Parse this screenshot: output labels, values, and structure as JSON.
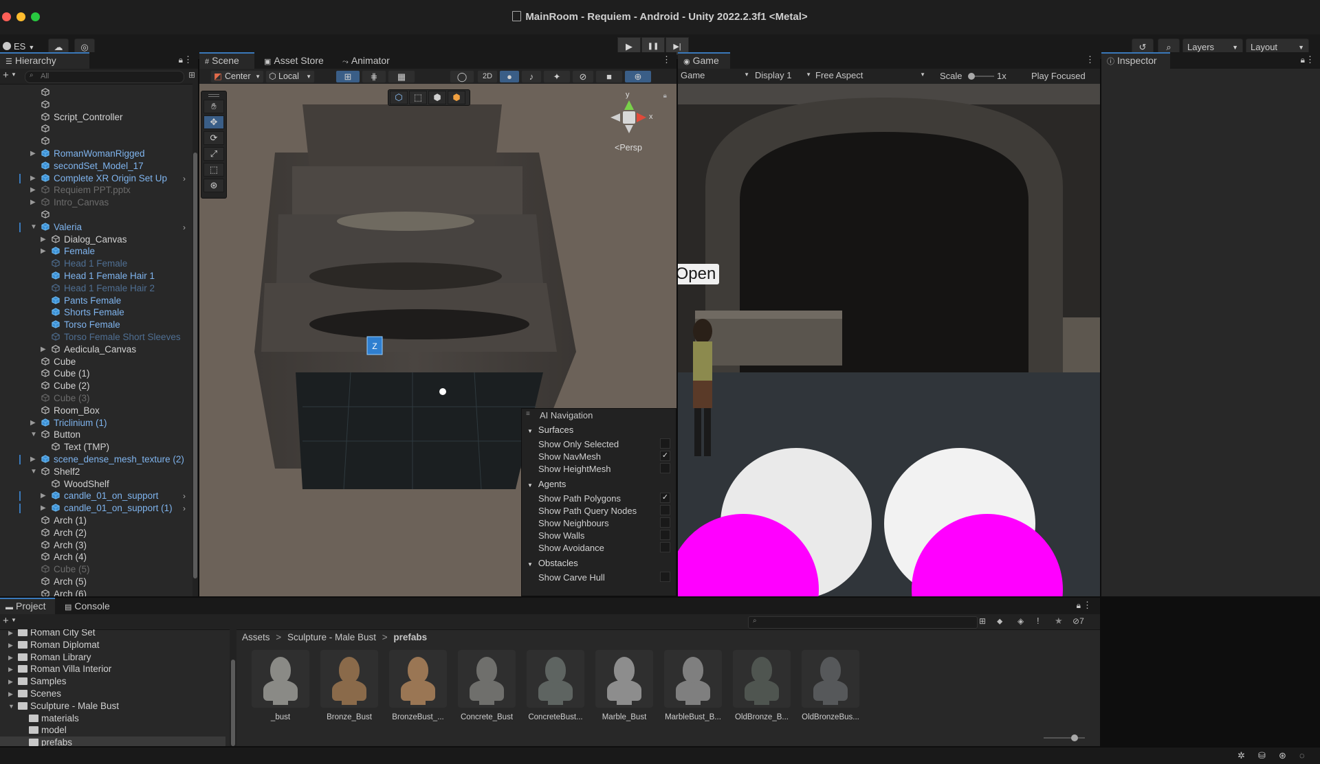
{
  "window": {
    "title": "MainRoom - Requiem - Android - Unity 2022.2.3f1 <Metal>"
  },
  "toolbar": {
    "account": "ES",
    "layers": "Layers",
    "layout": "Layout",
    "play_icon": "▶",
    "pause_icon": "❚❚",
    "step_icon": "▶|"
  },
  "hierarchy": {
    "tab": "Hierarchy",
    "search_placeholder": "All",
    "items": [
      {
        "label": "",
        "indent": 0,
        "style": "normal",
        "arrow": ""
      },
      {
        "label": "",
        "indent": 0,
        "style": "normal",
        "arrow": ""
      },
      {
        "label": "Script_Controller",
        "indent": 0,
        "style": "normal",
        "arrow": ""
      },
      {
        "label": "",
        "indent": 0,
        "style": "normal",
        "arrow": ""
      },
      {
        "label": "",
        "indent": 0,
        "style": "normal",
        "arrow": ""
      },
      {
        "label": "RomanWomanRigged",
        "indent": 0,
        "style": "prefab",
        "arrow": "▶"
      },
      {
        "label": "secondSet_Model_17",
        "indent": 0,
        "style": "prefab",
        "arrow": ""
      },
      {
        "label": "Complete XR Origin Set Up",
        "indent": 0,
        "style": "prefab",
        "arrow": "▶",
        "bar": true,
        "chev": true
      },
      {
        "label": "Requiem PPT.pptx",
        "indent": 0,
        "style": "dim",
        "arrow": "▶"
      },
      {
        "label": "Intro_Canvas",
        "indent": 0,
        "style": "dim",
        "arrow": "▶"
      },
      {
        "label": "",
        "indent": 0,
        "style": "normal",
        "arrow": ""
      },
      {
        "label": "Valeria",
        "indent": 0,
        "style": "prefab",
        "arrow": "▼",
        "bar": true,
        "chev": true
      },
      {
        "label": "Dialog_Canvas",
        "indent": 1,
        "style": "normal",
        "arrow": "▶"
      },
      {
        "label": "Female",
        "indent": 1,
        "style": "prefab",
        "arrow": "▶"
      },
      {
        "label": "Head 1 Female",
        "indent": 1,
        "style": "dimprefab",
        "arrow": ""
      },
      {
        "label": "Head 1 Female Hair 1",
        "indent": 1,
        "style": "prefab",
        "arrow": ""
      },
      {
        "label": "Head 1 Female Hair 2",
        "indent": 1,
        "style": "dimprefab",
        "arrow": ""
      },
      {
        "label": "Pants Female",
        "indent": 1,
        "style": "prefab",
        "arrow": ""
      },
      {
        "label": "Shorts Female",
        "indent": 1,
        "style": "prefab",
        "arrow": ""
      },
      {
        "label": "Torso Female",
        "indent": 1,
        "style": "prefab",
        "arrow": ""
      },
      {
        "label": "Torso Female Short Sleeves",
        "indent": 1,
        "style": "dimprefab",
        "arrow": ""
      },
      {
        "label": "Aedicula_Canvas",
        "indent": 1,
        "style": "normal",
        "arrow": "▶"
      },
      {
        "label": "Cube",
        "indent": 0,
        "style": "normal",
        "arrow": ""
      },
      {
        "label": "Cube (1)",
        "indent": 0,
        "style": "normal",
        "arrow": ""
      },
      {
        "label": "Cube (2)",
        "indent": 0,
        "style": "normal",
        "arrow": ""
      },
      {
        "label": "Cube (3)",
        "indent": 0,
        "style": "dim",
        "arrow": ""
      },
      {
        "label": "Room_Box",
        "indent": 0,
        "style": "normal",
        "arrow": ""
      },
      {
        "label": "Triclinium (1)",
        "indent": 0,
        "style": "prefab",
        "arrow": "▶"
      },
      {
        "label": "Button",
        "indent": 0,
        "style": "normal",
        "arrow": "▼"
      },
      {
        "label": "Text (TMP)",
        "indent": 1,
        "style": "normal",
        "arrow": ""
      },
      {
        "label": "scene_dense_mesh_texture (2)",
        "indent": 0,
        "style": "prefab",
        "arrow": "▶",
        "bar": true
      },
      {
        "label": "Shelf2",
        "indent": 0,
        "style": "normal",
        "arrow": "▼"
      },
      {
        "label": "WoodShelf",
        "indent": 1,
        "style": "normal",
        "arrow": ""
      },
      {
        "label": "candle_01_on_support",
        "indent": 1,
        "style": "prefab",
        "arrow": "▶",
        "bar": true,
        "chev": true
      },
      {
        "label": "candle_01_on_support (1)",
        "indent": 1,
        "style": "prefab",
        "arrow": "▶",
        "bar": true,
        "chev": true
      },
      {
        "label": "Arch (1)",
        "indent": 0,
        "style": "normal",
        "arrow": ""
      },
      {
        "label": "Arch (2)",
        "indent": 0,
        "style": "normal",
        "arrow": ""
      },
      {
        "label": "Arch (3)",
        "indent": 0,
        "style": "normal",
        "arrow": ""
      },
      {
        "label": "Arch (4)",
        "indent": 0,
        "style": "normal",
        "arrow": ""
      },
      {
        "label": "Cube (5)",
        "indent": 0,
        "style": "dim",
        "arrow": ""
      },
      {
        "label": "Arch (5)",
        "indent": 0,
        "style": "normal",
        "arrow": ""
      },
      {
        "label": "Arch (6)",
        "indent": 0,
        "style": "normal",
        "arrow": ""
      }
    ]
  },
  "scene": {
    "tabs": [
      "Scene",
      "Asset Store",
      "Animator"
    ],
    "pivot": "Center",
    "space": "Local",
    "mode_2d": "2D",
    "persp_label": "Persp",
    "axis_y": "y",
    "axis_x": "x",
    "gizmo_tag": "Z"
  },
  "ai_navigation": {
    "title": "AI Navigation",
    "sections": [
      {
        "header": "Surfaces",
        "items": [
          {
            "label": "Show Only Selected",
            "checked": false
          },
          {
            "label": "Show NavMesh",
            "checked": true
          },
          {
            "label": "Show HeightMesh",
            "checked": false
          }
        ]
      },
      {
        "header": "Agents",
        "items": [
          {
            "label": "Show Path Polygons",
            "checked": true
          },
          {
            "label": "Show Path Query Nodes",
            "checked": false
          },
          {
            "label": "Show Neighbours",
            "checked": false
          },
          {
            "label": "Show Walls",
            "checked": false
          },
          {
            "label": "Show Avoidance",
            "checked": false
          }
        ]
      },
      {
        "header": "Obstacles",
        "items": [
          {
            "label": "Show Carve Hull",
            "checked": false
          }
        ]
      }
    ],
    "check_mark": "✓"
  },
  "game": {
    "tab": "Game",
    "mode": "Game",
    "display": "Display 1",
    "aspect": "Free Aspect",
    "scale_label": "Scale",
    "scale_value": "1x",
    "play_focused": "Play Focused",
    "sign_text": "Open"
  },
  "inspector": {
    "tab": "Inspector"
  },
  "project": {
    "tabs": [
      "Project",
      "Console"
    ],
    "badge_count": "7",
    "tree": [
      {
        "label": "Roman City Set",
        "indent": 0,
        "open": false
      },
      {
        "label": "Roman Diplomat",
        "indent": 0,
        "open": false
      },
      {
        "label": "Roman Library",
        "indent": 0,
        "open": false
      },
      {
        "label": "Roman Villa Interior",
        "indent": 0,
        "open": false
      },
      {
        "label": "Samples",
        "indent": 0,
        "open": false
      },
      {
        "label": "Scenes",
        "indent": 0,
        "open": false
      },
      {
        "label": "Sculpture - Male Bust",
        "indent": 0,
        "open": true
      },
      {
        "label": "materials",
        "indent": 1,
        "open": false
      },
      {
        "label": "model",
        "indent": 1,
        "open": false
      },
      {
        "label": "prefabs",
        "indent": 1,
        "open": false,
        "selected": true
      }
    ],
    "breadcrumb": [
      "Assets",
      "Sculpture - Male Bust",
      "prefabs"
    ],
    "breadcrumb_sep": ">",
    "assets": [
      {
        "name": "_bust",
        "color": "#8a8a86"
      },
      {
        "name": "Bronze_Bust",
        "color": "#8a6a4a"
      },
      {
        "name": "BronzeBust_...",
        "color": "#9a7654"
      },
      {
        "name": "Concrete_Bust",
        "color": "#6f6f6c"
      },
      {
        "name": "ConcreteBust...",
        "color": "#5e6461"
      },
      {
        "name": "Marble_Bust",
        "color": "#8d8d8d"
      },
      {
        "name": "MarbleBust_B...",
        "color": "#7f7f7f"
      },
      {
        "name": "OldBronze_B...",
        "color": "#4f5550"
      },
      {
        "name": "OldBronzeBus...",
        "color": "#56585a"
      }
    ]
  }
}
